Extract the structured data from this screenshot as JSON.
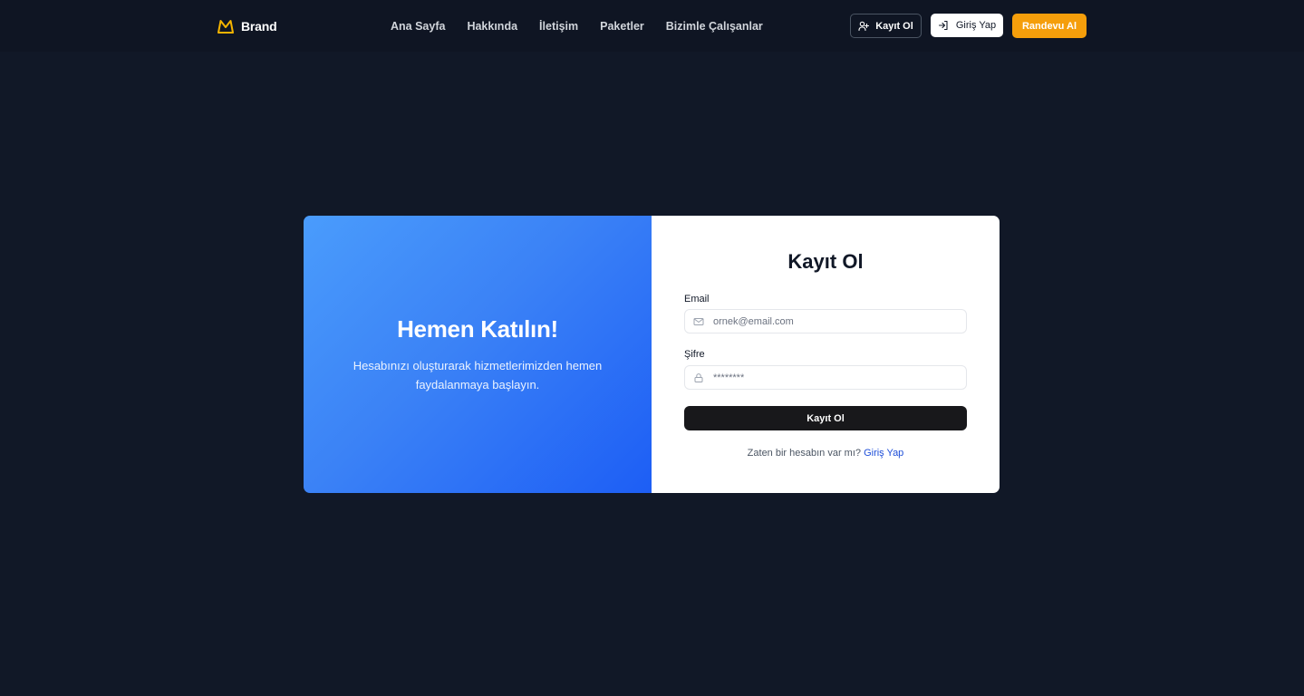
{
  "colors": {
    "page_bg": "#111827",
    "navbar_bg": "#0f1523",
    "accent_orange": "#f59e0b",
    "brand_icon": "#f5b400",
    "gradient_start": "#4a9cfc",
    "gradient_end": "#1d5ef5",
    "submit_bg": "#18181b",
    "link_blue": "#1d4ed8"
  },
  "navbar": {
    "brand": {
      "name": "Brand",
      "icon": "crown-icon"
    },
    "links": [
      {
        "label": "Ana Sayfa"
      },
      {
        "label": "Hakkında"
      },
      {
        "label": "İletişim"
      },
      {
        "label": "Paketler"
      },
      {
        "label": "Bizimle Çalışanlar"
      }
    ],
    "actions": {
      "register": {
        "label": "Kayıt Ol",
        "icon": "user-plus-icon"
      },
      "login": {
        "label": "Giriş Yap",
        "icon": "log-in-icon"
      },
      "appointment": {
        "label": "Randevu Al"
      }
    }
  },
  "hero": {
    "title": "Hemen Katılın!",
    "text": "Hesabınızı oluşturarak hizmetlerimizden hemen faydalanmaya başlayın."
  },
  "form": {
    "title": "Kayıt Ol",
    "email": {
      "label": "Email",
      "placeholder": "ornek@email.com",
      "icon": "mail-icon"
    },
    "password": {
      "label": "Şifre",
      "placeholder": "********",
      "icon": "lock-icon"
    },
    "submit_label": "Kayıt Ol",
    "footer": {
      "prompt": "Zaten bir hesabın var mı?",
      "link_label": "Giriş Yap"
    }
  }
}
